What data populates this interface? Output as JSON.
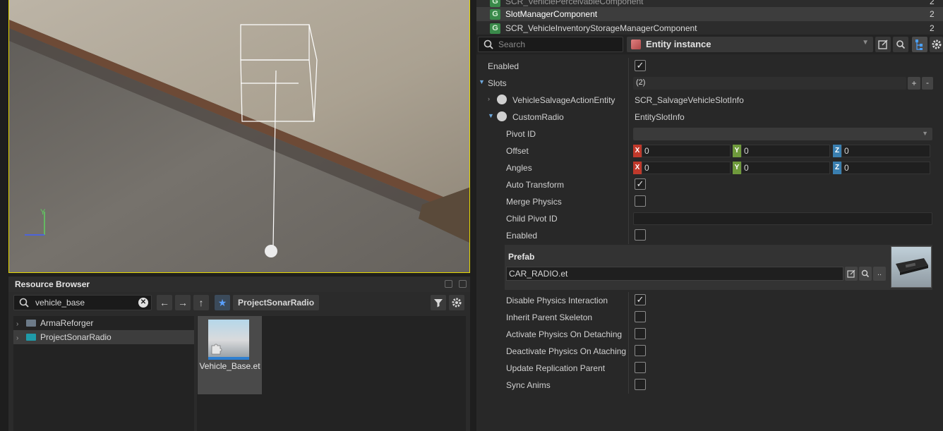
{
  "viewport": {
    "accent": "#e6d800"
  },
  "resource_browser": {
    "title": "Resource Browser",
    "search": {
      "value": "vehicle_base"
    },
    "breadcrumb": "ProjectSonarRadio",
    "tree": [
      {
        "label": "ArmaReforger",
        "selected": false
      },
      {
        "label": "ProjectSonarRadio",
        "selected": true
      }
    ],
    "assets": [
      {
        "label": "Vehicle_Base.et"
      }
    ]
  },
  "components": [
    {
      "name": "SCR_VehiclePerceivableComponent",
      "count": "2",
      "selected": false
    },
    {
      "name": "SlotManagerComponent",
      "count": "2",
      "selected": true
    },
    {
      "name": "SCR_VehicleInventoryStorageManagerComponent",
      "count": "2",
      "selected": false
    }
  ],
  "inspector": {
    "search_placeholder": "Search",
    "entity_type": "Entity instance",
    "props": {
      "enabled": "Enabled",
      "slots": "Slots",
      "slots_count": "(2)",
      "slot1_name": "VehicleSalvageActionEntity",
      "slot1_type": "SCR_SalvageVehicleSlotInfo",
      "slot2_name": "CustomRadio",
      "slot2_type": "EntitySlotInfo",
      "pivot_id": "Pivot ID",
      "offset": "Offset",
      "angles": "Angles",
      "auto_transform": "Auto Transform",
      "merge_physics": "Merge Physics",
      "child_pivot_id": "Child Pivot ID",
      "enabled2": "Enabled",
      "prefab": "Prefab",
      "prefab_value": "CAR_RADIO.et",
      "disable_physics": "Disable Physics Interaction",
      "inherit_skeleton": "Inherit Parent Skeleton",
      "activate_physics": "Activate Physics On Detaching",
      "deactivate_physics": "Deactivate Physics On Ataching",
      "update_replication": "Update Replication Parent",
      "sync_anims": "Sync Anims"
    },
    "vec_labels": {
      "x": "X",
      "y": "Y",
      "z": "Z"
    },
    "offset": {
      "x": "0",
      "y": "0",
      "z": "0"
    },
    "angles": {
      "x": "0",
      "y": "0",
      "z": "0"
    },
    "checkbox_glyph": "✓",
    "slot_buttons": {
      "add": "+",
      "remove": "-"
    },
    "prefab_more": ".."
  },
  "colors": {
    "x_axis": "#c0392b",
    "y_axis": "#6f9a3c",
    "z_axis": "#3a7fb0",
    "selection": "#3d3d3d"
  }
}
